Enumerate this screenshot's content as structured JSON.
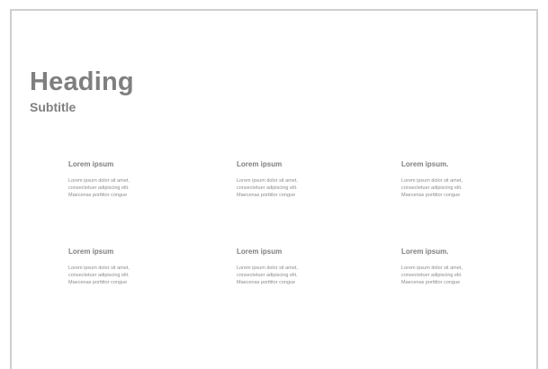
{
  "slide": {
    "heading": "Heading",
    "subtitle": "Subtitle"
  },
  "cards": [
    {
      "title": "Lorem ipsum",
      "lines": [
        "Lorem ipsum dolor sit amet,",
        "consectetuer adipiscing elit.",
        "Maecenas porttitor congue"
      ]
    },
    {
      "title": "Lorem ipsum",
      "lines": [
        "Lorem ipsum dolor sit amet,",
        "consectetuer adipiscing elit.",
        "Maecenas porttitor congue"
      ]
    },
    {
      "title": "Lorem ipsum.",
      "lines": [
        "Lorem ipsum dolor sit amet,",
        "consectetuer adipiscing elit.",
        "Maecenas porttitor congue"
      ]
    },
    {
      "title": "Lorem ipsum",
      "lines": [
        "Lorem ipsum dolor sit amet,",
        "consectetuer adipiscing elit.",
        "Maecenas porttitor congue"
      ]
    },
    {
      "title": "Lorem ipsum",
      "lines": [
        "Lorem ipsum dolor sit amet,",
        "consectetuer adipiscing elit.",
        "Maecenas porttitor congue"
      ]
    },
    {
      "title": "Lorem ipsum.",
      "lines": [
        "Lorem ipsum dolor sit amet,",
        "consectetuer adipiscing elit.",
        "Maecenas porttitor congue"
      ]
    }
  ]
}
